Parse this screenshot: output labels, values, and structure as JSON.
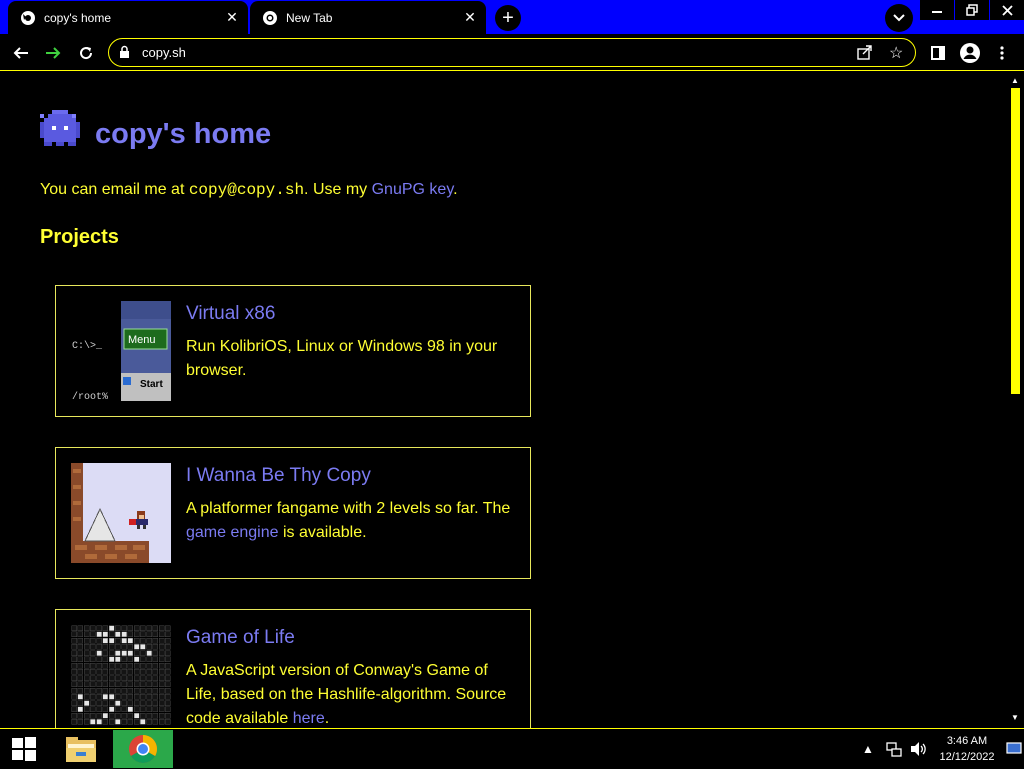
{
  "browser": {
    "tabs": [
      {
        "title": "copy's home",
        "active": true
      },
      {
        "title": "New Tab",
        "active": false
      }
    ],
    "url": "copy.sh"
  },
  "page": {
    "title": "copy's home",
    "intro": {
      "prefix": "You can email me at ",
      "email": "copy@copy.sh",
      "middle": ". Use my ",
      "gpg_link": "GnuPG key",
      "suffix": "."
    },
    "projects_heading": "Projects",
    "projects": [
      {
        "title": "Virtual x86",
        "description": "Run KolibriOS, Linux or Windows 98 in your browser.",
        "thumb": {
          "prompt1": "C:\\>_",
          "prompt2": "/root%",
          "menu": "Menu",
          "start": "Start"
        }
      },
      {
        "title": "I Wanna Be Thy Copy",
        "description_pre": "A platformer fangame with 2 levels so far. The ",
        "link": "game engine",
        "description_post": " is available."
      },
      {
        "title": "Game of Life",
        "description_pre": "A JavaScript version of Conway's Game of Life, based on the Hashlife-algorithm. Source code available ",
        "link": "here",
        "description_post": "."
      }
    ]
  },
  "taskbar": {
    "time": "3:46 AM",
    "date": "12/12/2022"
  },
  "colors": {
    "accent_link": "#7b7bf2",
    "text_yellow": "#ffff33",
    "tabstrip_blue": "#0000ff",
    "chrome_task_green": "#2ba84a"
  }
}
